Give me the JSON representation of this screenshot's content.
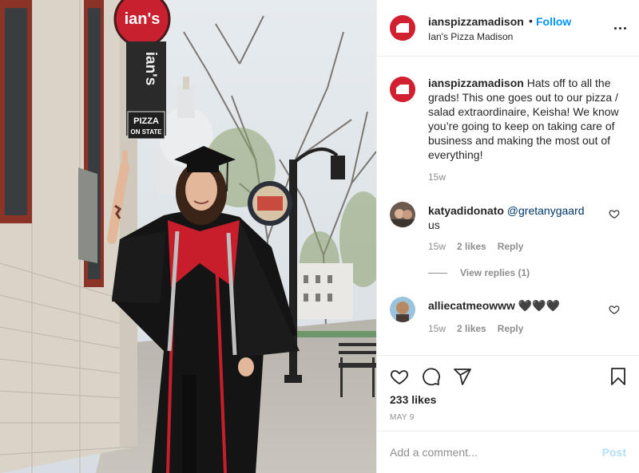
{
  "header": {
    "username": "ianspizzamadison",
    "separator": "•",
    "follow_label": "Follow",
    "location": "Ian's Pizza Madison",
    "more_icon": "more-options-icon"
  },
  "photo": {
    "sign_logo_text": "ian's",
    "sign_vertical_text": "ian's",
    "sign_pizza_text": "PIZZA",
    "sign_onstate_text": "ON STATE"
  },
  "caption": {
    "username": "ianspizzamadison",
    "text": "Hats off to all the grads! This one goes out to our pizza / salad extraordinaire, Keisha! We know you’re going to keep on taking care of business and making the most out of everything!",
    "time": "15w"
  },
  "comments": [
    {
      "username": "katyadidonato",
      "mention": "@gretanygaard",
      "text": "us",
      "time": "15w",
      "likes": "2 likes",
      "reply_label": "Reply"
    },
    {
      "username": "alliecatmeowww",
      "text": "🖤🖤🖤",
      "time": "15w",
      "likes": "2 likes",
      "reply_label": "Reply"
    }
  ],
  "view_replies": "View replies (1)",
  "actions": {
    "likes": "233 likes",
    "date": "MAY 9"
  },
  "add_comment": {
    "placeholder": "Add a comment...",
    "post_label": "Post"
  },
  "colors": {
    "brand_red": "#d1202f",
    "link_blue": "#0095f6",
    "post_disabled": "#b2dffc",
    "muted": "#8e8e8e"
  }
}
